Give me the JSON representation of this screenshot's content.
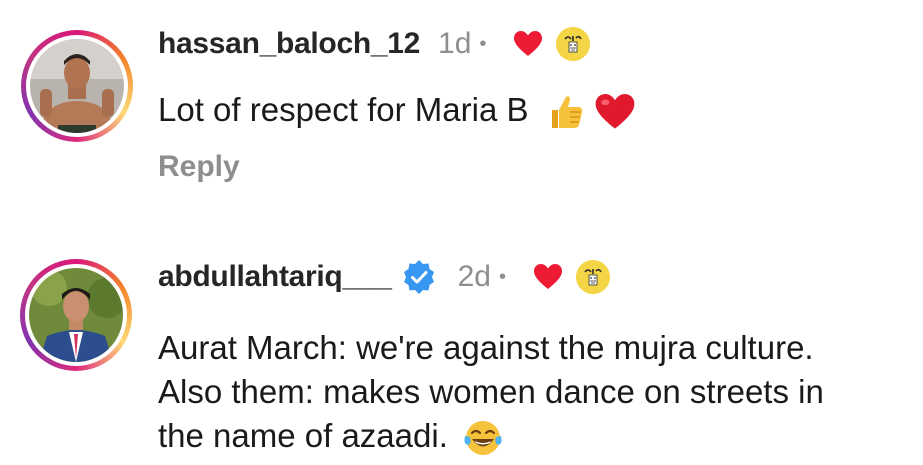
{
  "comments": [
    {
      "username": "hassan_baloch_12",
      "time": "1d",
      "separator": "•",
      "verified": false,
      "text": "Lot of respect for Maria B",
      "text_emojis": [
        "thumbs-up",
        "red-heart"
      ],
      "reply_label": "Reply",
      "reaction_icon": "red-heart",
      "badge_icon": "creator-badge"
    },
    {
      "username": "abdullahtariq___",
      "time": "2d",
      "separator": "•",
      "verified": true,
      "text_lines": [
        "Aurat March: we're against the mujra culture.",
        "Also them: makes women dance on streets in",
        "the name of azaadi."
      ],
      "text_emojis": [
        "tears-of-joy"
      ],
      "reaction_icon": "red-heart",
      "badge_icon": "creator-badge"
    }
  ],
  "colors": {
    "username": "#262626",
    "muted": "#8e8e8e",
    "heart": "#ed1c34",
    "verified": "#3897f0",
    "badge": "#f4d545"
  }
}
